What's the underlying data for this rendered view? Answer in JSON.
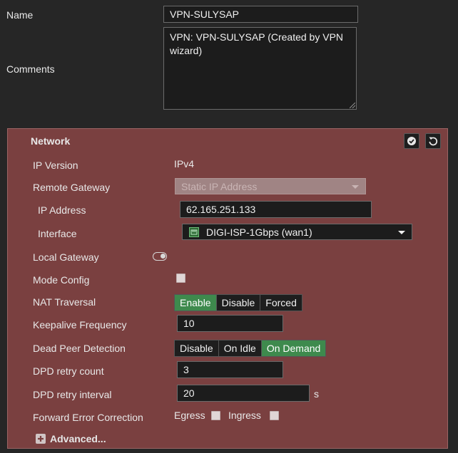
{
  "general": {
    "name_label": "Name",
    "name_value": "VPN-SULYSAP",
    "comments_label": "Comments",
    "comments_value": "VPN: VPN-SULYSAP (Created by VPN wizard)"
  },
  "network": {
    "title": "Network",
    "ip_version_label": "IP Version",
    "ip_version_value": "IPv4",
    "remote_gateway_label": "Remote Gateway",
    "remote_gateway_value": "Static IP Address",
    "ip_address_label": "IP Address",
    "ip_address_value": "62.165.251.133",
    "interface_label": "Interface",
    "interface_value": "DIGI-ISP-1Gbps (wan1)",
    "local_gateway_label": "Local Gateway",
    "local_gateway_enabled": false,
    "mode_config_label": "Mode Config",
    "mode_config_checked": false,
    "nat_traversal_label": "NAT Traversal",
    "nat_traversal_options": [
      "Enable",
      "Disable",
      "Forced"
    ],
    "nat_traversal_selected": "Enable",
    "keepalive_label": "Keepalive Frequency",
    "keepalive_value": "10",
    "dpd_label": "Dead Peer Detection",
    "dpd_options": [
      "Disable",
      "On Idle",
      "On Demand"
    ],
    "dpd_selected": "On Demand",
    "dpd_retry_count_label": "DPD retry count",
    "dpd_retry_count_value": "3",
    "dpd_retry_interval_label": "DPD retry interval",
    "dpd_retry_interval_value": "20",
    "dpd_retry_interval_unit": "s",
    "fec_label": "Forward Error Correction",
    "fec_egress_label": "Egress",
    "fec_ingress_label": "Ingress",
    "fec_egress_checked": false,
    "fec_ingress_checked": false,
    "advanced_label": "Advanced..."
  },
  "colors": {
    "page_bg": "#262626",
    "panel_bg": "#7a4040",
    "toggle_active": "#3e8a4d"
  }
}
